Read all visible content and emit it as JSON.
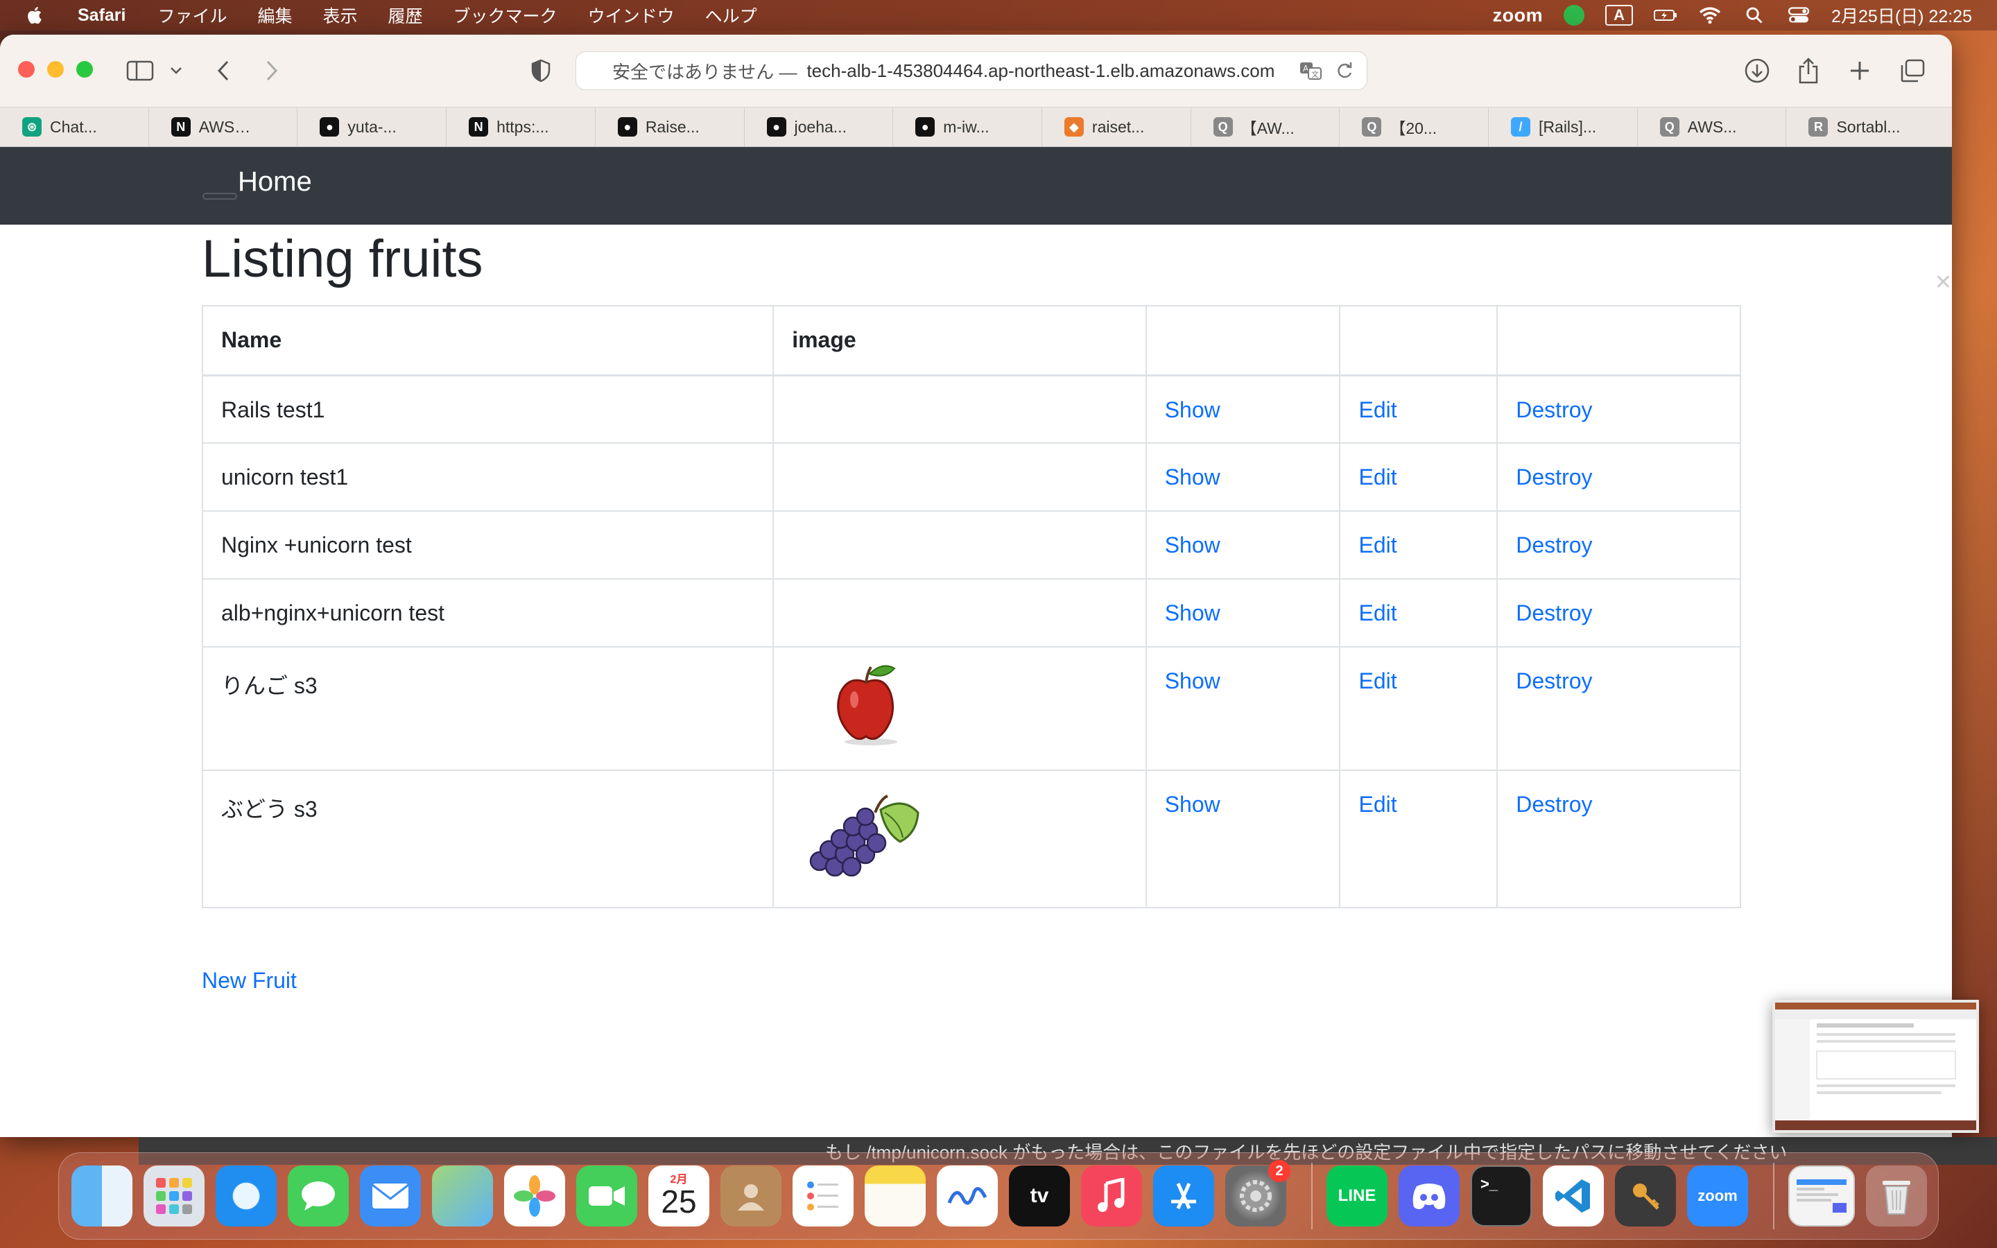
{
  "menubar": {
    "app_name": "Safari",
    "items": [
      "ファイル",
      "編集",
      "表示",
      "履歴",
      "ブックマーク",
      "ウインドウ",
      "ヘルプ"
    ],
    "zoom": "zoom",
    "ime": "A",
    "datetime": "2月25日(日)  22:25"
  },
  "browser": {
    "url_prefix": "安全ではありません —",
    "url_host": "tech-alb-1-453804464.ap-northeast-1.elb.amazonaws.com",
    "favorites": [
      {
        "label": "Chat...",
        "icon": "chatgpt-icon",
        "color": "#10a37f",
        "glyph": "⊛"
      },
      {
        "label": "AWS…",
        "icon": "notion-icon",
        "color": "#111111",
        "glyph": "N"
      },
      {
        "label": "yuta-...",
        "icon": "github-icon",
        "color": "#111111",
        "glyph": "●"
      },
      {
        "label": "https:...",
        "icon": "notion-icon",
        "color": "#111111",
        "glyph": "N"
      },
      {
        "label": "Raise...",
        "icon": "github-icon",
        "color": "#111111",
        "glyph": "●"
      },
      {
        "label": "joeha...",
        "icon": "github-icon",
        "color": "#111111",
        "glyph": "●"
      },
      {
        "label": "m-iw...",
        "icon": "github-icon",
        "color": "#111111",
        "glyph": "●"
      },
      {
        "label": "raiset...",
        "icon": "box-icon",
        "color": "#ec7a2c",
        "glyph": "◆"
      },
      {
        "label": "【AW...",
        "icon": "qiita-icon",
        "color": "#888888",
        "glyph": "Q"
      },
      {
        "label": "【20...",
        "icon": "qiita-icon",
        "color": "#888888",
        "glyph": "Q"
      },
      {
        "label": "[Rails]...",
        "icon": "zenn-icon",
        "color": "#3ea8ff",
        "glyph": "/"
      },
      {
        "label": "AWS...",
        "icon": "qiita-icon",
        "color": "#888888",
        "glyph": "Q"
      },
      {
        "label": "Sortabl...",
        "icon": "r-icon",
        "color": "#888888",
        "glyph": "R"
      }
    ]
  },
  "page": {
    "brand": "Home",
    "title": "Listing fruits",
    "columns": [
      "Name",
      "image",
      "",
      "",
      ""
    ],
    "rows": [
      {
        "name": "Rails test1",
        "image": "",
        "show": "Show",
        "edit": "Edit",
        "destroy": "Destroy"
      },
      {
        "name": "unicorn test1",
        "image": "",
        "show": "Show",
        "edit": "Edit",
        "destroy": "Destroy"
      },
      {
        "name": "Nginx +unicorn test",
        "image": "",
        "show": "Show",
        "edit": "Edit",
        "destroy": "Destroy"
      },
      {
        "name": "alb+nginx+unicorn test",
        "image": "",
        "show": "Show",
        "edit": "Edit",
        "destroy": "Destroy"
      },
      {
        "name": "りんご s3",
        "image": "apple",
        "show": "Show",
        "edit": "Edit",
        "destroy": "Destroy"
      },
      {
        "name": "ぶどう s3",
        "image": "grapes",
        "show": "Show",
        "edit": "Edit",
        "destroy": "Destroy"
      }
    ],
    "new_link": "New Fruit",
    "link_color": "#0d6efd"
  },
  "background_text": "もし /tmp/unicorn.sock がもった場合は、このファイルを先ほどの設定ファイル中で指定したパスに移動させてください",
  "dock": {
    "calendar_month": "2月",
    "calendar_day": "25",
    "settings_badge": "2",
    "apps": [
      "finder",
      "launchpad",
      "safari",
      "messages",
      "mail",
      "maps",
      "photos",
      "facetime",
      "calendar",
      "contacts",
      "reminders",
      "notes",
      "freeform",
      "tv",
      "music",
      "appstore",
      "settings",
      "line",
      "discord",
      "terminal",
      "vscode",
      "keychain",
      "zoom",
      "preview",
      "trash"
    ]
  }
}
